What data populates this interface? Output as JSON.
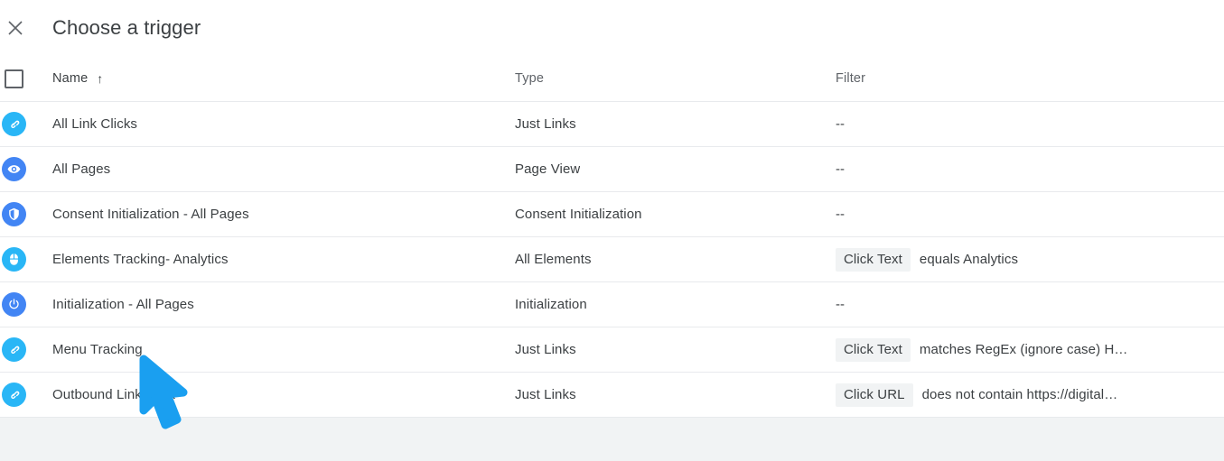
{
  "header": {
    "close_icon": "close-icon",
    "title": "Choose a trigger"
  },
  "table": {
    "columns": {
      "name": "Name",
      "sort_arrow": "↑",
      "type": "Type",
      "filter": "Filter"
    },
    "empty_filter": "--",
    "rows": [
      {
        "icon": "link-icon",
        "icon_color": "#29b6f6",
        "name": "All Link Clicks",
        "type": "Just Links",
        "filter_chip": "",
        "filter_value": "--"
      },
      {
        "icon": "eye-icon",
        "icon_color": "#4285f4",
        "name": "All Pages",
        "type": "Page View",
        "filter_chip": "",
        "filter_value": "--"
      },
      {
        "icon": "shield-icon",
        "icon_color": "#4285f4",
        "name": "Consent Initialization - All Pages",
        "type": "Consent Initialization",
        "filter_chip": "",
        "filter_value": "--"
      },
      {
        "icon": "mouse-icon",
        "icon_color": "#29b6f6",
        "name": "Elements Tracking- Analytics",
        "type": "All Elements",
        "filter_chip": "Click Text",
        "filter_value": "equals Analytics"
      },
      {
        "icon": "power-icon",
        "icon_color": "#4285f4",
        "name": "Initialization - All Pages",
        "type": "Initialization",
        "filter_chip": "",
        "filter_value": "--"
      },
      {
        "icon": "link-icon",
        "icon_color": "#29b6f6",
        "name": "Menu Tracking",
        "type": "Just Links",
        "filter_chip": "Click Text",
        "filter_value": "matches RegEx (ignore case) H…"
      },
      {
        "icon": "link-icon",
        "icon_color": "#29b6f6",
        "name": "Outbound Link Click",
        "type": "Just Links",
        "filter_chip": "Click URL",
        "filter_value": "does not contain https://digital…"
      }
    ]
  },
  "cursor": {
    "name": "mouse-cursor",
    "color": "#1a9ff0"
  }
}
